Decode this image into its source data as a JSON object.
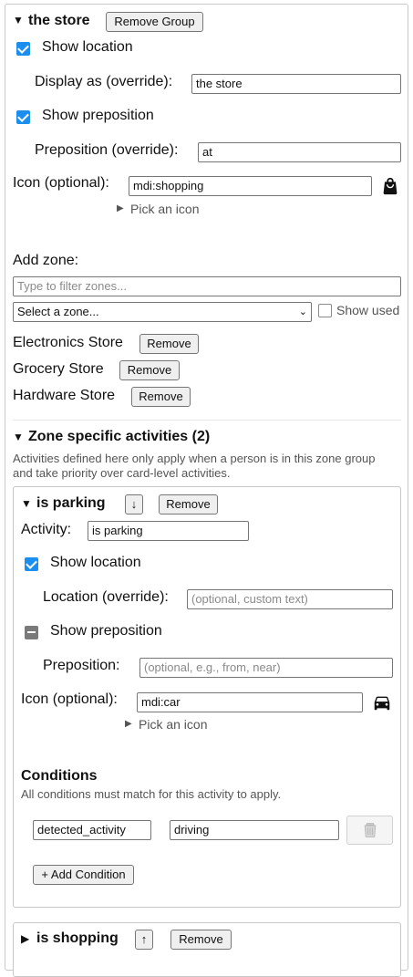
{
  "group": {
    "title": "the store",
    "remove_group_label": "Remove Group",
    "show_location_label": "Show location",
    "display_as_label": "Display as (override):",
    "display_as_value": "the store",
    "show_preposition_label": "Show preposition",
    "preposition_label": "Preposition (override):",
    "preposition_value": "at",
    "icon_label": "Icon (optional):",
    "icon_value": "mdi:shopping",
    "pick_icon_label": "Pick an icon"
  },
  "zones": {
    "add_zone_label": "Add zone:",
    "filter_placeholder": "Type to filter zones...",
    "select_value": "Select a zone...",
    "show_used_label": "Show used",
    "remove_label": "Remove",
    "items": [
      {
        "name": "Electronics Store"
      },
      {
        "name": "Grocery Store"
      },
      {
        "name": "Hardware Store"
      }
    ]
  },
  "activities": {
    "header": "Zone specific activities (2)",
    "description_line1": "Activities defined here only apply when a person is in this zone group",
    "description_line2": "and take priority over card-level activities.",
    "parking": {
      "title": "is parking",
      "move_down_label": "↓",
      "remove_label": "Remove",
      "activity_label": "Activity:",
      "activity_value": "is parking",
      "show_location_label": "Show location",
      "location_label": "Location (override):",
      "location_placeholder": "(optional, custom text)",
      "show_preposition_label": "Show preposition",
      "preposition_label": "Preposition:",
      "preposition_placeholder": "(optional, e.g., from, near)",
      "icon_label": "Icon (optional):",
      "icon_value": "mdi:car",
      "pick_icon_label": "Pick an icon",
      "conditions_title": "Conditions",
      "conditions_desc": "All conditions must match for this activity to apply.",
      "condition_entity": "detected_activity",
      "condition_value": "driving",
      "add_condition_label": "+ Add Condition"
    },
    "shopping": {
      "title": "is shopping",
      "move_up_label": "↑",
      "remove_label": "Remove"
    }
  }
}
